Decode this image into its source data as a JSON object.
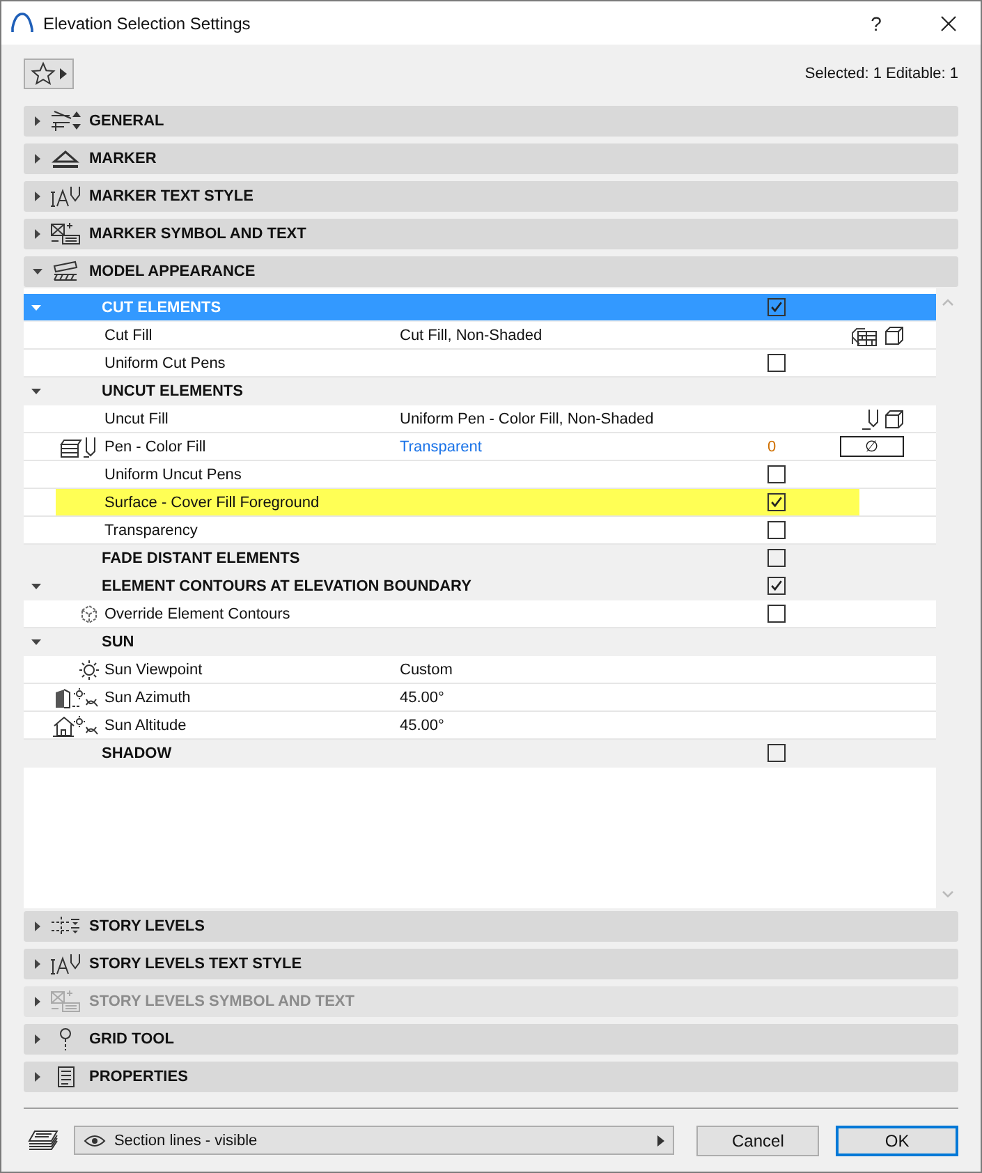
{
  "window": {
    "title": "Elevation Selection Settings",
    "help": "?"
  },
  "toolbar": {
    "selection_info": "Selected: 1 Editable: 1"
  },
  "panels": [
    {
      "label": "GENERAL",
      "kind": "general",
      "expanded": false,
      "disabled": false
    },
    {
      "label": "MARKER",
      "kind": "marker",
      "expanded": false,
      "disabled": false
    },
    {
      "label": "MARKER TEXT STYLE",
      "kind": "text-style",
      "expanded": false,
      "disabled": false
    },
    {
      "label": "MARKER SYMBOL AND TEXT",
      "kind": "symbol",
      "expanded": false,
      "disabled": false
    },
    {
      "label": "MODEL APPEARANCE",
      "kind": "model",
      "expanded": true,
      "disabled": false,
      "tree": [
        {
          "kind": "group",
          "label": "CUT ELEMENTS",
          "expanded": true,
          "selected": true,
          "checked": true,
          "children": [
            {
              "kind": "fill",
              "label": "Cut Fill",
              "value": "Cut Fill, Non-Shaded",
              "selected": false
            },
            {
              "kind": "check",
              "label": "Uniform Cut Pens",
              "checked": false,
              "selected": false
            }
          ]
        },
        {
          "kind": "group",
          "label": "UNCUT ELEMENTS",
          "expanded": true,
          "selected": false,
          "children": [
            {
              "kind": "pen-fill",
              "label": "Uncut Fill",
              "value": "Uniform Pen - Color Fill, Non-Shaded",
              "selected": false
            },
            {
              "kind": "pen",
              "label": "Pen - Color Fill",
              "value": "Transparent",
              "pen_number": "0",
              "swatch": "∅",
              "selected": false
            },
            {
              "kind": "check",
              "label": "Uniform Uncut Pens",
              "checked": false,
              "selected": false
            },
            {
              "kind": "check",
              "label": "Surface - Cover Fill Foreground",
              "checked": true,
              "highlighted": true,
              "selected": false
            },
            {
              "kind": "check",
              "label": "Transparency",
              "checked": false,
              "selected": false
            }
          ]
        },
        {
          "kind": "group",
          "label": "FADE DISTANT ELEMENTS",
          "selected": false,
          "checked": false
        },
        {
          "kind": "group",
          "label": "ELEMENT CONTOURS AT ELEVATION BOUNDARY",
          "expanded": true,
          "selected": false,
          "checked": true,
          "children": [
            {
              "kind": "contours",
              "label": "Override Element Contours",
              "checked": false,
              "selected": false
            }
          ]
        },
        {
          "kind": "group",
          "label": "SUN",
          "expanded": true,
          "selected": false,
          "children": [
            {
              "kind": "viewpoint",
              "label": "Sun Viewpoint",
              "value": "Custom",
              "selected": false
            },
            {
              "kind": "azimuth",
              "label": "Sun Azimuth",
              "value": "45.00°",
              "selected": false
            },
            {
              "kind": "altitude",
              "label": "Sun Altitude",
              "value": "45.00°",
              "selected": false
            }
          ]
        },
        {
          "kind": "group",
          "label": "SHADOW",
          "selected": false,
          "checked": false
        }
      ]
    },
    {
      "label": "STORY LEVELS",
      "kind": "levels",
      "expanded": false,
      "disabled": false
    },
    {
      "label": "STORY LEVELS TEXT STYLE",
      "kind": "text-style",
      "expanded": false,
      "disabled": false
    },
    {
      "label": "STORY LEVELS SYMBOL AND TEXT",
      "kind": "symbol",
      "expanded": false,
      "disabled": true
    },
    {
      "label": "GRID TOOL",
      "kind": "grid",
      "expanded": false,
      "disabled": false
    },
    {
      "label": "PROPERTIES",
      "kind": "properties",
      "expanded": false,
      "disabled": false
    }
  ],
  "footer": {
    "layer_dropdown": "Section lines - visible",
    "buttons": [
      {
        "label": "Cancel",
        "default": false
      },
      {
        "label": "OK",
        "default": true
      }
    ]
  }
}
